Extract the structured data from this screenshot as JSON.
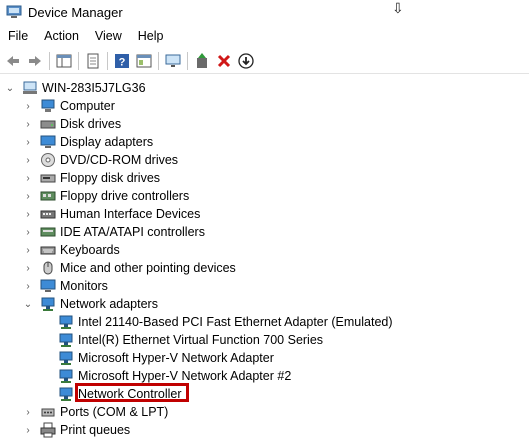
{
  "window": {
    "title": "Device Manager"
  },
  "menu": [
    "File",
    "Action",
    "View",
    "Help"
  ],
  "toolbar": {
    "buttons": [
      "back-icon",
      "forward-icon",
      "properties-pane-icon",
      "document-icon",
      "help-icon",
      "console-icon",
      "monitor-icon",
      "update-driver-icon",
      "uninstall-icon",
      "download-icon"
    ]
  },
  "tree": {
    "root": "WIN-283I5J7LG36",
    "categories": [
      "Computer",
      "Disk drives",
      "Display adapters",
      "DVD/CD-ROM drives",
      "Floppy disk drives",
      "Floppy drive controllers",
      "Human Interface Devices",
      "IDE ATA/ATAPI controllers",
      "Keyboards",
      "Mice and other pointing devices",
      "Monitors",
      "Network adapters",
      "Ports (COM & LPT)",
      "Print queues"
    ],
    "network_children": [
      "Intel 21140-Based PCI Fast Ethernet Adapter (Emulated)",
      "Intel(R) Ethernet Virtual Function 700 Series",
      "Microsoft Hyper-V Network Adapter",
      "Microsoft Hyper-V Network Adapter #2",
      "Network Controller"
    ]
  },
  "colors": {
    "highlight": "#c00000",
    "netIcon": "#3a8fd0"
  }
}
